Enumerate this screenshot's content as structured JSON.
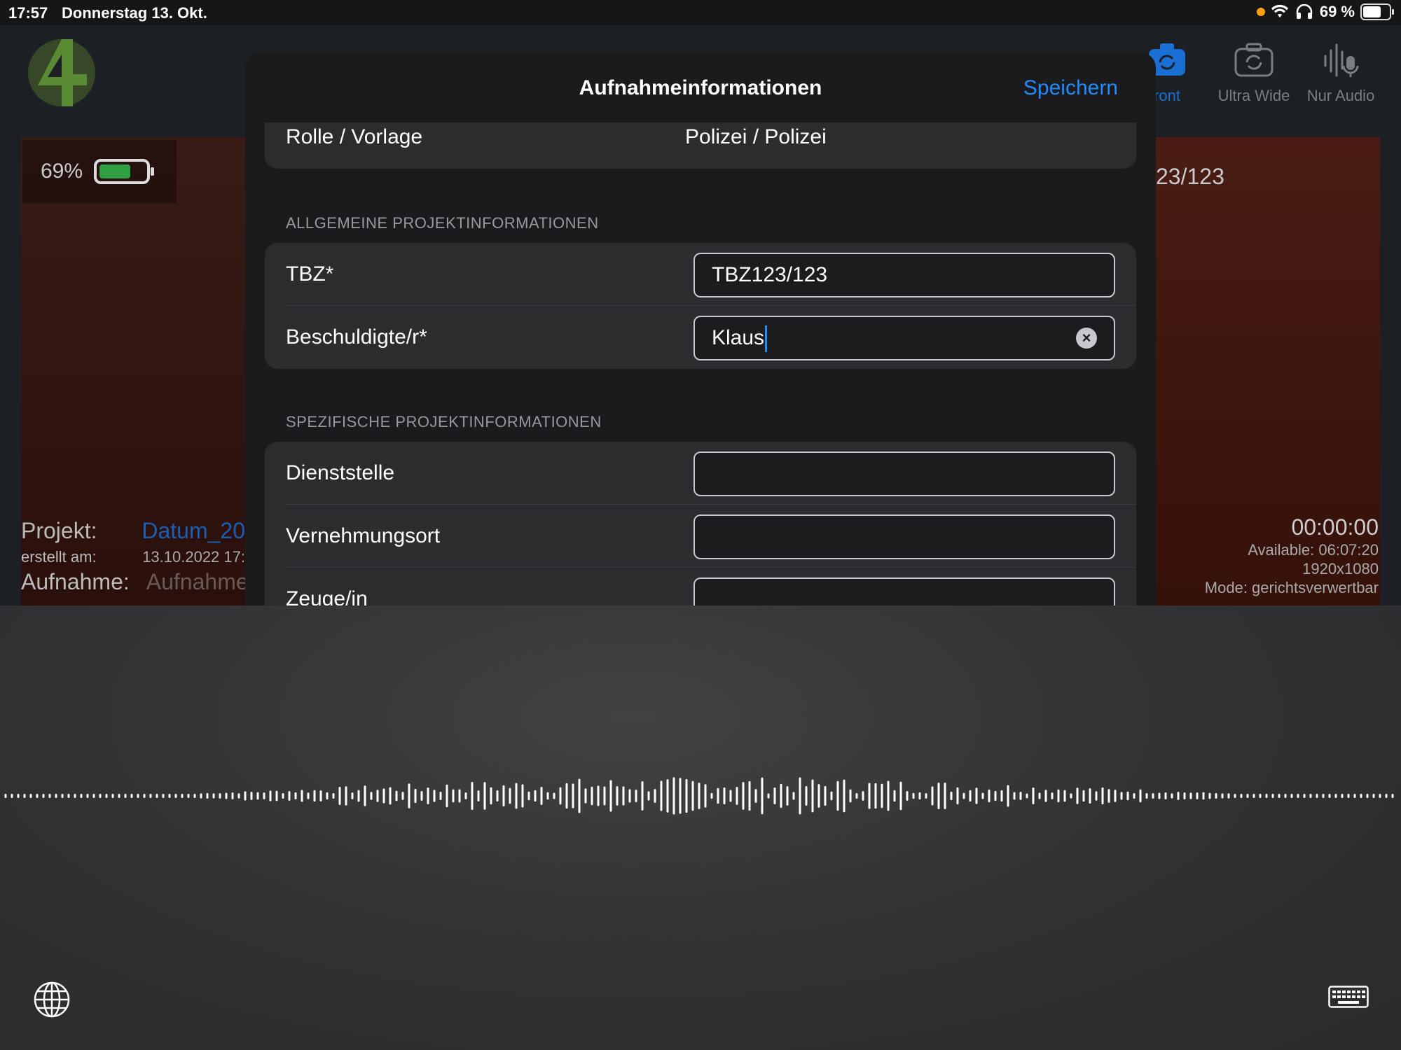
{
  "status_bar": {
    "time": "17:57",
    "date": "Donnerstag 13. Okt.",
    "battery": "69 %",
    "battery_level": 0.69
  },
  "background": {
    "battery_percent": "69%",
    "battery_level": 0.69,
    "project_label": "Projekt:",
    "project_value": "Datum_20",
    "created_label": "erstellt am:",
    "created_value": "13.10.2022 17:",
    "recording_label": "Aufnahme:",
    "recording_value": "Aufnahme",
    "tbz_peek": "23/123",
    "modes": [
      {
        "label": "ront",
        "icon": "camera-rotate-icon",
        "active": true
      },
      {
        "label": "Ultra Wide",
        "icon": "camera-rotate-icon",
        "active": false
      },
      {
        "label": "Nur Audio",
        "icon": "microphone-waveform-icon",
        "active": false
      }
    ],
    "timer": "00:00:00",
    "available": "Available: 06:07:20",
    "resolution": "1920x1080",
    "mode": "Mode: gerichtsverwertbar",
    "accent": "#1a6fd4"
  },
  "modal": {
    "title": "Aufnahmeinformationen",
    "save_label": "Speichern",
    "rolle": {
      "label": "Rolle / Vorlage",
      "value": "Polizei / Polizei"
    },
    "section_general": "ALLGEMEINE PROJEKTINFORMATIONEN",
    "general_fields": [
      {
        "label": "TBZ*",
        "value": "TBZ123/123"
      },
      {
        "label": "Beschuldigte/r*",
        "value": "Klaus"
      }
    ],
    "section_specific": "SPEZIFISCHE PROJEKTINFORMATIONEN",
    "specific_fields": [
      {
        "label": "Dienststelle",
        "value": ""
      },
      {
        "label": "Vernehmungsort",
        "value": ""
      },
      {
        "label": "Zeuge/in",
        "value": ""
      }
    ],
    "accent": "#1e8cff"
  },
  "dictation": {
    "globe_icon": "globe-icon",
    "keyboard_icon": "keyboard-icon"
  }
}
